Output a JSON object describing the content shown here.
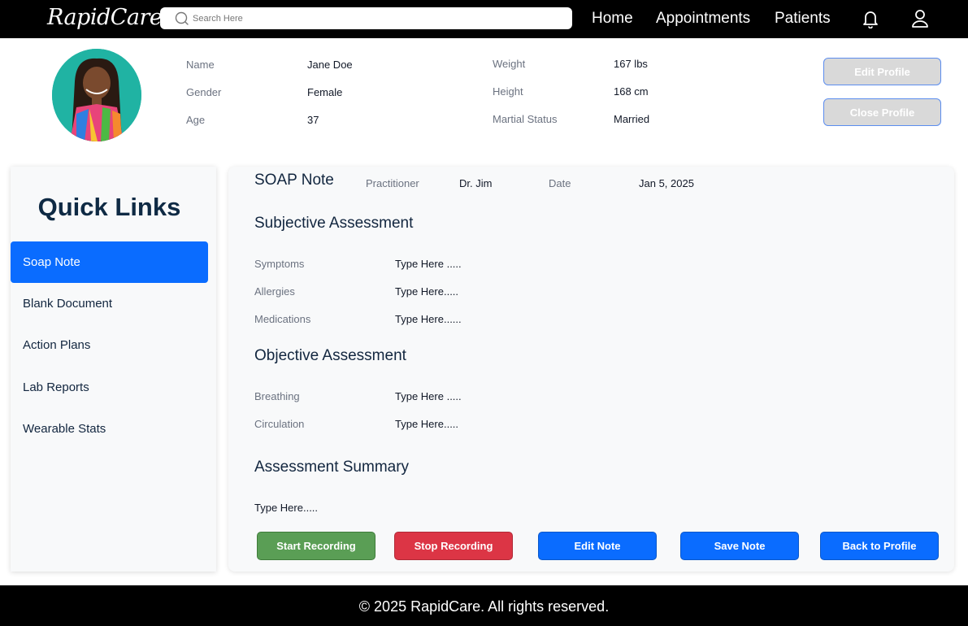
{
  "app": {
    "logo": "RapidCare"
  },
  "search": {
    "placeholder": "Search Here"
  },
  "nav": {
    "home": "Home",
    "appointments": "Appointments",
    "patients": "Patients"
  },
  "profile": {
    "name_label": "Name",
    "name": "Jane Doe",
    "gender_label": "Gender",
    "gender": "Female",
    "age_label": "Age",
    "age": "37",
    "weight_label": "Weight",
    "weight": "167 lbs",
    "height_label": "Height",
    "height": "168 cm",
    "marital_label": "Martial Status",
    "marital": "Married",
    "edit_button": "Edit Profile",
    "close_button": "Close Profile"
  },
  "quick_links": {
    "title": "Quick Links",
    "items": [
      {
        "label": "Soap Note",
        "active": true
      },
      {
        "label": "Blank Document",
        "active": false
      },
      {
        "label": "Action Plans",
        "active": false
      },
      {
        "label": "Lab Reports",
        "active": false
      },
      {
        "label": "Wearable Stats",
        "active": false
      }
    ]
  },
  "soap": {
    "title": "SOAP Note",
    "practitioner_label": "Practitioner",
    "practitioner": "Dr. Jim",
    "date_label": "Date",
    "date": "Jan 5, 2025",
    "subjective_title": "Subjective Assessment",
    "symptoms_label": "Symptoms",
    "symptoms": "Type Here .....",
    "allergies_label": "Allergies",
    "allergies": "Type Here.....",
    "medications_label": "Medications",
    "medications": "Type Here......",
    "objective_title": "Objective Assessment",
    "breathing_label": "Breathing",
    "breathing": "Type Here .....",
    "circulation_label": "Circulation",
    "circulation": "Type Here.....",
    "summary_title": "Assessment Summary",
    "summary": "Type Here.....",
    "buttons": {
      "start": "Start Recording",
      "stop": "Stop Recording",
      "edit": "Edit  Note",
      "save": "Save Note",
      "back": "Back to Profile"
    }
  },
  "colors": {
    "primary": "#0a6cff",
    "start": "#5a9e55",
    "stop": "#dc3545",
    "nav_bg": "#000000"
  },
  "footer": {
    "text": "© 2025 RapidCare. All rights reserved."
  }
}
